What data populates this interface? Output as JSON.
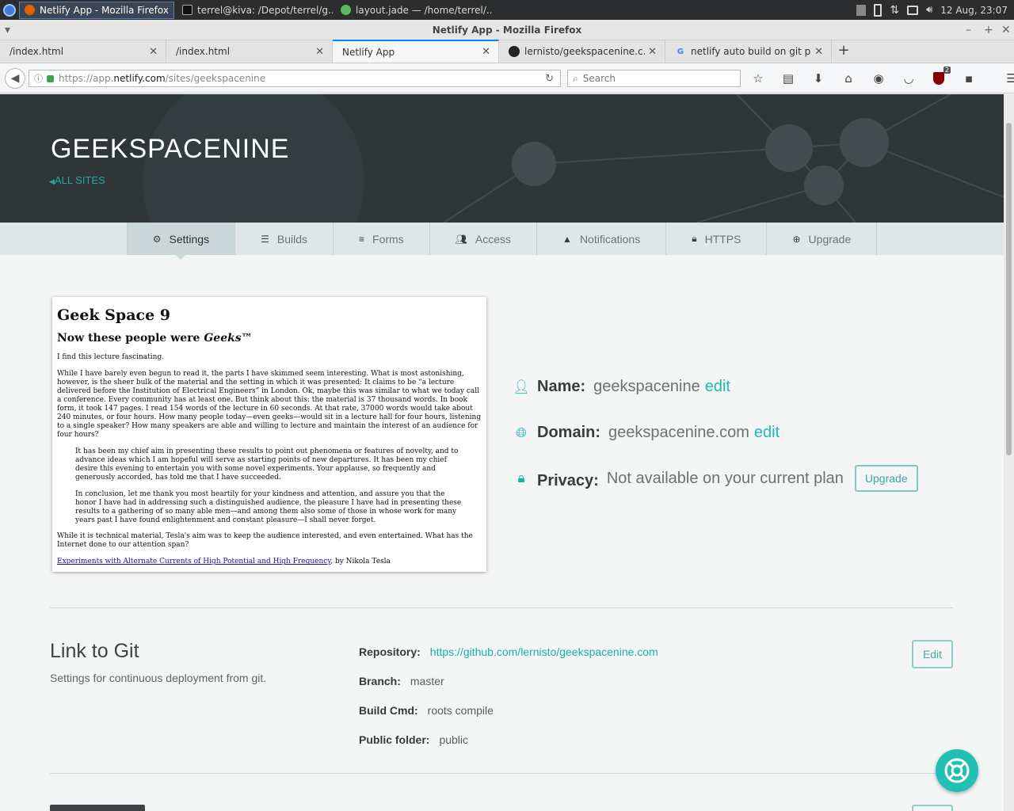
{
  "taskbar": {
    "tasks": [
      {
        "label": "Netlify App - Mozilla Firefox"
      },
      {
        "label": "terrel@kiva: /Depot/terrel/g..."
      },
      {
        "label": "layout.jade — /home/terrel/..."
      }
    ],
    "clock": "12 Aug, 23:07"
  },
  "window": {
    "title": "Netlify App - Mozilla Firefox"
  },
  "tabs": [
    {
      "label": "/index.html"
    },
    {
      "label": "/index.html"
    },
    {
      "label": "Netlify App"
    },
    {
      "label": "lernisto/geekspacenine.c..."
    },
    {
      "label": "netlify auto build on git p..."
    }
  ],
  "nav": {
    "url_prefix": "https://app.",
    "url_host": "netlify.com",
    "url_path": "/sites/geekspacenine",
    "search_placeholder": "Search",
    "badge_count": "2"
  },
  "hero": {
    "title": "GEEKSPACENINE",
    "back_label": "ALL SITES"
  },
  "subnav": [
    {
      "label": "Settings",
      "icon": "gear-icon"
    },
    {
      "label": "Builds",
      "icon": "database-icon"
    },
    {
      "label": "Forms",
      "icon": "list-icon"
    },
    {
      "label": "Access",
      "icon": "users-icon"
    },
    {
      "label": "Notifications",
      "icon": "warning-icon"
    },
    {
      "label": "HTTPS",
      "icon": "lock-icon"
    },
    {
      "label": "Upgrade",
      "icon": "plus-circle-icon"
    }
  ],
  "preview": {
    "h1": "Geek Space 9",
    "h2_prefix": "Now these people were ",
    "h2_em": "Geeks™",
    "p1": "I find this lecture fascinating.",
    "p2": "While I have barely even begun to read it, the parts I have skimmed seem interesting. What is most astonishing, however, is the sheer bulk of the material and the setting in which it was presented: It claims to be “a lecture delivered before the Institution of Electrical Engineers” in London. Ok, maybe this was similar to what we today call a conference. Every community has at least one. But think about this: the material is 37 thousand words. In book form, it took 147 pages. I read 154 words of the lecture in 60 seconds. At that rate, 37000 words would take about 240 minutes, or four hours. How many people today—even geeks—would sit in a lecture hall for four hours, listening to a single speaker? How many speakers are able and willing to lecture and maintain the interest of an audience for four hours?",
    "q1": "It has been my chief aim in presenting these results to point out phenomena or features of novelty, and to advance ideas which I am hopeful will serve as starting points of new departures. It has been my chief desire this evening to entertain you with some novel experiments. Your applause, so frequently and generously accorded, has told me that I have succeeded.",
    "q2": "In conclusion, let me thank you most heartily for your kindness and attention, and assure you that the honor I have had in addressing such a distinguished audience, the pleasure I have had in presenting these results to a gathering of so many able men—and among them also some of those in whose work for many years past I have found enlightenment and constant pleasure—I shall never forget.",
    "p3": "While it is technical material, Tesla's aim was to keep the audience interested, and even entertained. What has the Internet done to our attention span?",
    "link": "Experiments with Alternate Currents of High Potential and High Frequency",
    "link_suffix": ", by Nikola Tesla"
  },
  "site_info": {
    "name_label": "Name:",
    "name_value": "geekspacenine",
    "name_edit": "edit",
    "domain_label": "Domain:",
    "domain_value": "geekspacenine.com",
    "domain_edit": "edit",
    "privacy_label": "Privacy:",
    "privacy_value": "Not available on your current plan",
    "upgrade_label": "Upgrade"
  },
  "git": {
    "title": "Link to Git",
    "desc": "Settings for continuous deployment from git.",
    "repo_label": "Repository:",
    "repo_value": "https://github.com/lernisto/geekspacenine.com",
    "branch_label": "Branch:",
    "branch_value": "master",
    "cmd_label": "Build Cmd:",
    "cmd_value": "roots compile",
    "folder_label": "Public folder:",
    "folder_value": "public",
    "edit_label": "Edit"
  },
  "colors": {
    "accent": "#20c0b4",
    "hero_bg": "#2f3638",
    "subnav_bg": "#dfe6e7"
  }
}
